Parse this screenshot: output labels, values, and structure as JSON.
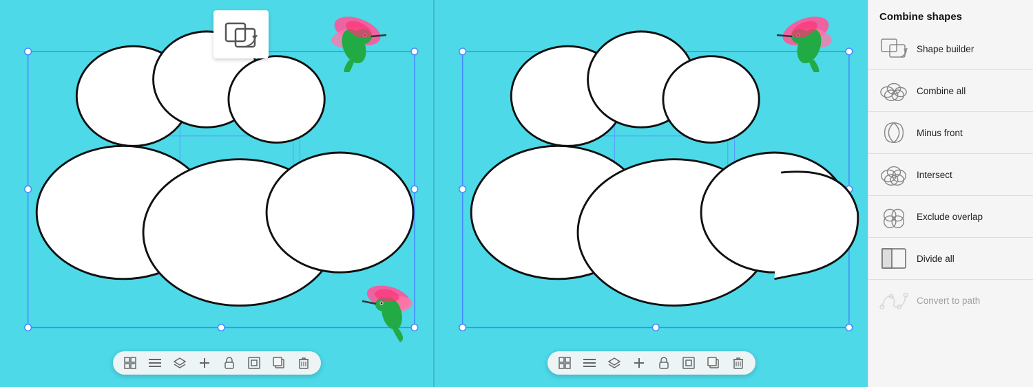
{
  "panel": {
    "title": "Combine shapes",
    "items": [
      {
        "id": "shape-builder",
        "label": "Shape builder",
        "disabled": false
      },
      {
        "id": "combine-all",
        "label": "Combine all",
        "disabled": false
      },
      {
        "id": "minus-front",
        "label": "Minus front",
        "disabled": false
      },
      {
        "id": "intersect",
        "label": "Intersect",
        "disabled": false
      },
      {
        "id": "exclude-overlap",
        "label": "Exclude overlap",
        "disabled": false
      },
      {
        "id": "divide-all",
        "label": "Divide all",
        "disabled": false
      },
      {
        "id": "convert-to-path",
        "label": "Convert to path",
        "disabled": true
      }
    ]
  },
  "toolbar": {
    "icons": [
      "⊞",
      "≡",
      "⇅",
      "+",
      "🔓",
      "⊡",
      "⊞",
      "🗑"
    ]
  }
}
